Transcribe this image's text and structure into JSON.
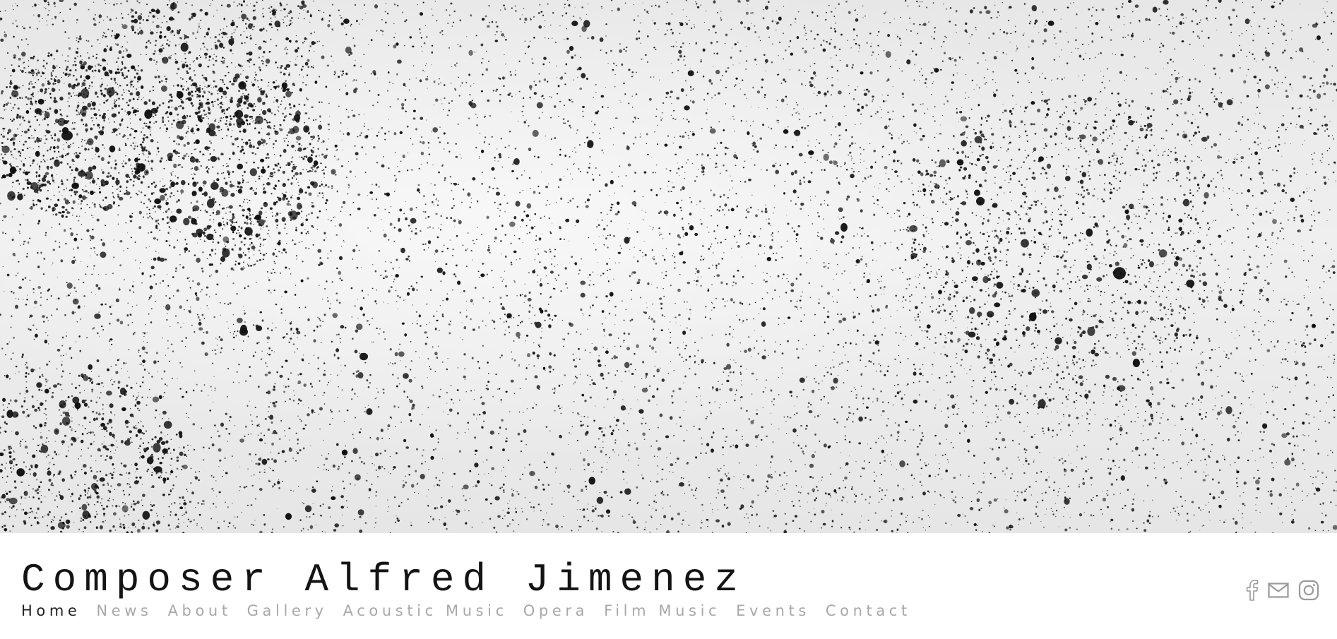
{
  "header": {
    "site_title": "Composer Alfred Jimenez"
  },
  "nav": {
    "items": [
      {
        "label": "Home",
        "active": true
      },
      {
        "label": "News",
        "active": false
      },
      {
        "label": "About",
        "active": false
      },
      {
        "label": "Gallery",
        "active": false
      },
      {
        "label": "Acoustic Music",
        "active": false
      },
      {
        "label": "Opera",
        "active": false
      },
      {
        "label": "Film Music",
        "active": false
      },
      {
        "label": "Events",
        "active": false
      },
      {
        "label": "Contact",
        "active": false
      }
    ]
  },
  "social": {
    "icons": [
      "facebook-icon",
      "mail-icon",
      "instagram-icon"
    ]
  },
  "colors": {
    "nav_active": "#222222",
    "nav_inactive": "#a8a8a8",
    "title": "#141414",
    "icon": "#9a9a9a"
  }
}
